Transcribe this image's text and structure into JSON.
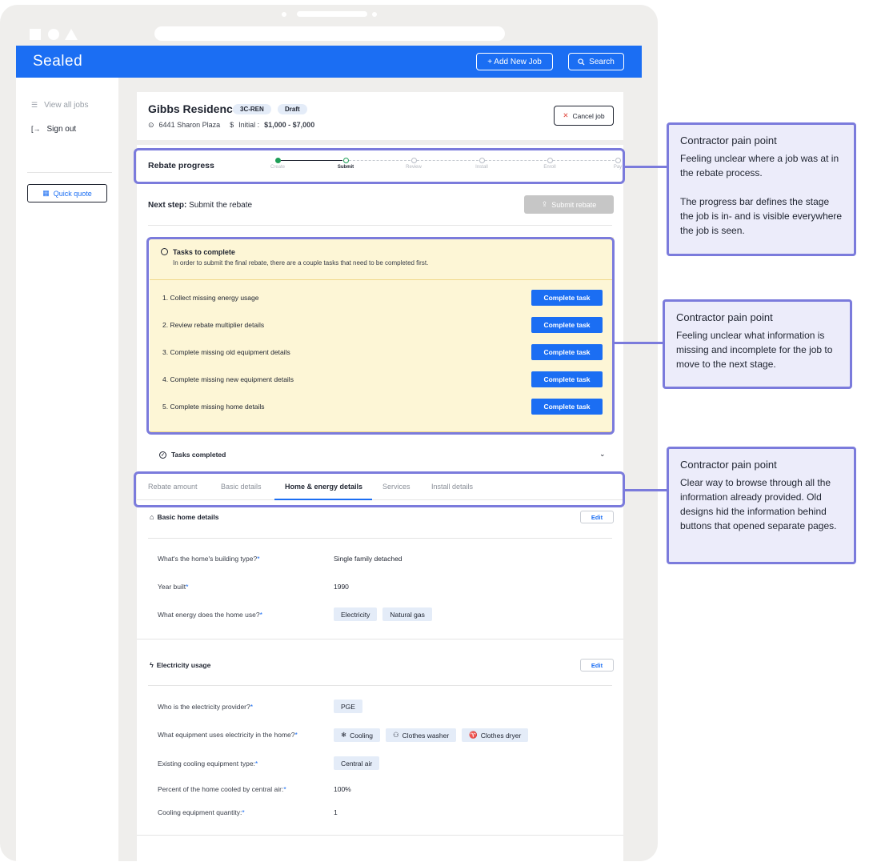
{
  "app": {
    "logo": "Sealed",
    "add_job": "+ Add New Job",
    "search": "Search"
  },
  "sidebar": {
    "view_all": "View all jobs",
    "sign_out": "Sign out",
    "quick_quote": "Quick quote"
  },
  "job": {
    "title": "Gibbs Residence",
    "badge_code": "3C-REN",
    "badge_status": "Draft",
    "address": "6441 Sharon Plaza",
    "initial_label": "Initial :",
    "initial_value": "$1,000 - $7,000",
    "cancel": "Cancel job"
  },
  "progress": {
    "label": "Rebate progress",
    "steps": [
      "Create",
      "Submit",
      "Review",
      "Install",
      "Enroll",
      "Pay"
    ]
  },
  "next_step": {
    "label": "Next step:",
    "value": "Submit the rebate",
    "submit": "Submit rebate"
  },
  "tasks": {
    "title": "Tasks to complete",
    "subtitle": "In order to submit the final rebate, there are a couple tasks that need to be completed first.",
    "items": [
      "1. Collect missing energy usage",
      "2. Review rebate multiplier details",
      "3. Complete missing old equipment details",
      "4. Complete missing new equipment details",
      "5. Complete missing home details"
    ],
    "button": "Complete task",
    "completed": "Tasks completed"
  },
  "tabs": [
    "Rebate amount",
    "Basic details",
    "Home & energy details",
    "Services",
    "Install details"
  ],
  "home": {
    "title": "Basic home details",
    "edit": "Edit",
    "building_q": "What's the home's building type?",
    "building_a": "Single family detached",
    "year_q": "Year built",
    "year_a": "1990",
    "energy_q": "What energy does the home use?",
    "energy_a": [
      "Electricity",
      "Natural gas"
    ]
  },
  "electric": {
    "title": "Electricity usage",
    "edit": "Edit",
    "provider_q": "Who is the electricity provider?",
    "provider_a": "PGE",
    "equip_q": "What equipment uses electricity in the home?",
    "equip_a": [
      "Cooling",
      "Clothes washer",
      "Clothes dryer"
    ],
    "cool_q": "Existing cooling equipment type:",
    "cool_a": "Central air",
    "pct_q": "Percent of the home cooled by central air:",
    "pct_a": "100%",
    "qty_q": "Cooling equipment quantity:",
    "qty_a": "1"
  },
  "notes": [
    {
      "title": "Contractor pain point",
      "body": "Feeling unclear where a job was at in the rebate process.\n\nThe progress bar defines the stage the job is in- and is visible everywhere the job is seen."
    },
    {
      "title": "Contractor pain point",
      "body": "Feeling unclear what information is missing and incomplete for the job to move to the next stage."
    },
    {
      "title": "Contractor pain point",
      "body": "Clear way to browse through all the information already provided. Old designs hid the information behind buttons that opened separate pages."
    }
  ],
  "colors": {
    "brand": "#1b6ef3",
    "annotation": "#7b7bdc",
    "success": "#1e9e57"
  }
}
